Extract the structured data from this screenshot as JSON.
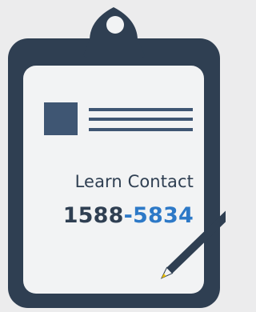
{
  "label": "Learn Contact",
  "phone": {
    "prefix": "1588",
    "separator": "-",
    "suffix": "5834"
  },
  "colors": {
    "background": "#ececed",
    "board_outline": "#2f3f52",
    "paper": "#f2f3f4",
    "accent_blue": "#2d79c7",
    "pencil_tip": "#f2c200"
  },
  "icons": {
    "clipboard": "clipboard-icon",
    "clip": "clip-icon",
    "pencil": "pencil-icon",
    "document_thumbnail": "image-placeholder-icon"
  }
}
